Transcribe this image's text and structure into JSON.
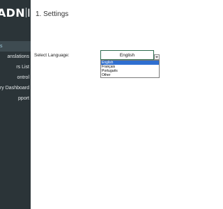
{
  "sidebar": {
    "brand": {
      "left": "ADN",
      "right": "IA"
    },
    "items": [
      {
        "label": "s"
      },
      {
        "label": "anslations"
      },
      {
        "label": "rs List"
      },
      {
        "label": "ontrol"
      },
      {
        "label": "ry Dashboard"
      },
      {
        "label": "pport"
      }
    ]
  },
  "main": {
    "title": "1. Settings",
    "language_label": "Select Language:",
    "language_select": {
      "selected": "English",
      "options": [
        "English",
        "Français",
        "Português",
        "Other"
      ],
      "highlighted_option": "English"
    }
  },
  "colors": {
    "sidebar_bg": "#2b3438",
    "active_item_bg": "#3e4b51",
    "active_item_text": "#9ec9db",
    "select_border": "#2e6b4f",
    "option_highlight": "#2f6fd0"
  }
}
